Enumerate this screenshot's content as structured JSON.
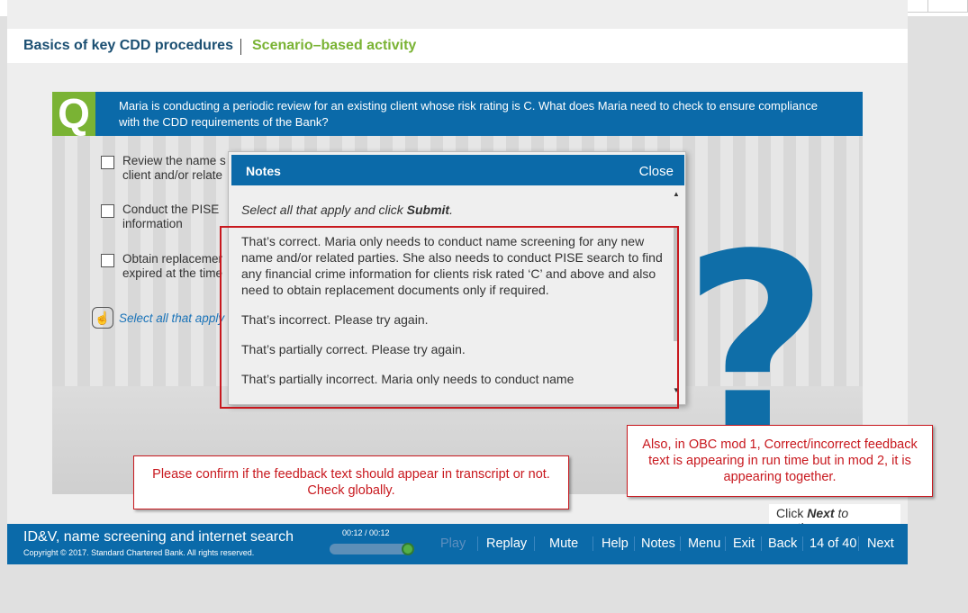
{
  "header": {
    "course_title": "Basics of key CDD procedures",
    "section_title": "Scenario–based activity"
  },
  "question": {
    "label": "Q",
    "text": "Maria is conducting a periodic review for an existing client whose risk rating is C. What does Maria need to check to ensure compliance with the CDD requirements of the Bank?"
  },
  "options": [
    {
      "text": "Review the name s\nclient and/or relate"
    },
    {
      "text": "Conduct the PISE\ninformation"
    },
    {
      "text": "Obtain replacemer\nexpired at the time"
    }
  ],
  "hint": {
    "text": "Select all that apply"
  },
  "notes": {
    "title": "Notes",
    "close_label": "Close",
    "lead": "Select all that apply and click Submit.",
    "paragraphs": [
      "That’s correct. Maria only needs to conduct name screening for any new name and/or related parties. She also needs to conduct PISE search to find any financial crime information for clients risk rated ‘C’ and above and also need to obtain replacement documents only if required.",
      "That’s incorrect. Please try again.",
      "That’s partially correct. Please try again.",
      "That’s partially incorrect. Maria only needs to conduct name"
    ]
  },
  "annotations": {
    "left": "Please confirm if the feedback text should appear in transcript or not. Check globally.",
    "right": "Also, in OBC mod 1, Correct/incorrect feedback text is appearing in run time but in mod 2, it is appearing together."
  },
  "click_next": "Click Next to continue",
  "footer": {
    "module_title": "ID&V, name screening and internet search",
    "copyright": "Copyright © 2017. Standard Chartered Bank. All rights reserved.",
    "time": "00:12 / 00:12",
    "play": "Play",
    "replay": "Replay",
    "mute": "Mute",
    "help": "Help",
    "notes": "Notes",
    "menu": "Menu",
    "exit": "Exit",
    "back": "Back",
    "page": "14 of 40",
    "next": "Next"
  },
  "colors": {
    "brand_blue": "#0b6aa9",
    "brand_green": "#7ab334",
    "annotation_red": "#c8181e"
  }
}
